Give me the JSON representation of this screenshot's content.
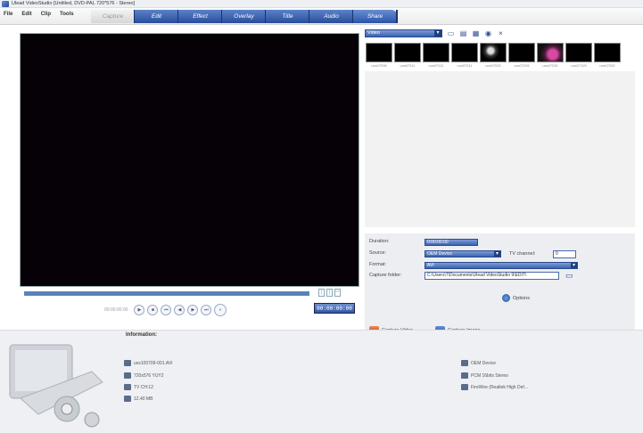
{
  "window": {
    "title": "Ulead VideoStudio [Untitled, DVD-PAL 720*576 - Stereo]"
  },
  "menu": [
    "File",
    "Edit",
    "Clip",
    "Tools"
  ],
  "tabs": [
    "Capture",
    "Edit",
    "Effect",
    "Overlay",
    "Title",
    "Audio",
    "Share"
  ],
  "active_tab": "Capture",
  "preview": {
    "progress": 0
  },
  "transport": {
    "time_label": "00:00:00:00",
    "timecode": "00:00:00:00"
  },
  "trim_icons": [
    "mark-in-icon",
    "mark-out-icon",
    "cut-icon"
  ],
  "library": {
    "category": "Video",
    "toolbar_icons": [
      "folder-icon",
      "import-icon",
      "library-manager-icon",
      "options-icon",
      "close-icon"
    ],
    "clips": [
      "uvs07008",
      "uvs07011",
      "uvs07011",
      "uvs07011",
      "uvs07025",
      "uvs07026",
      "uvs07030",
      "uvs07103",
      "uvs07002"
    ]
  },
  "settings": {
    "duration_label": "Duration:",
    "duration_value": "0:00:00:00",
    "source_label": "Source:",
    "source_value": "OEM Device",
    "tv_channel_label": "TV channel:",
    "tv_channel_value": "0",
    "format_label": "Format:",
    "format_value": "AVI",
    "folder_label": "Capture folder:",
    "folder_value": "C:\\Users\\7\\Documents\\Ulead VideoStudio 9\\EDIT\\",
    "options_label": "Options",
    "capture_video": "Capture Video",
    "capture_image": "Capture Image"
  },
  "information": {
    "title": "Information:",
    "left": [
      "uvs100709-001.AVI",
      "720x576 YUY2",
      "TV CH:12",
      "12.40 MB"
    ],
    "right": [
      "OEM Device",
      "PCM 16bits Stereo",
      "FireWire (Realtek High Def..."
    ]
  }
}
